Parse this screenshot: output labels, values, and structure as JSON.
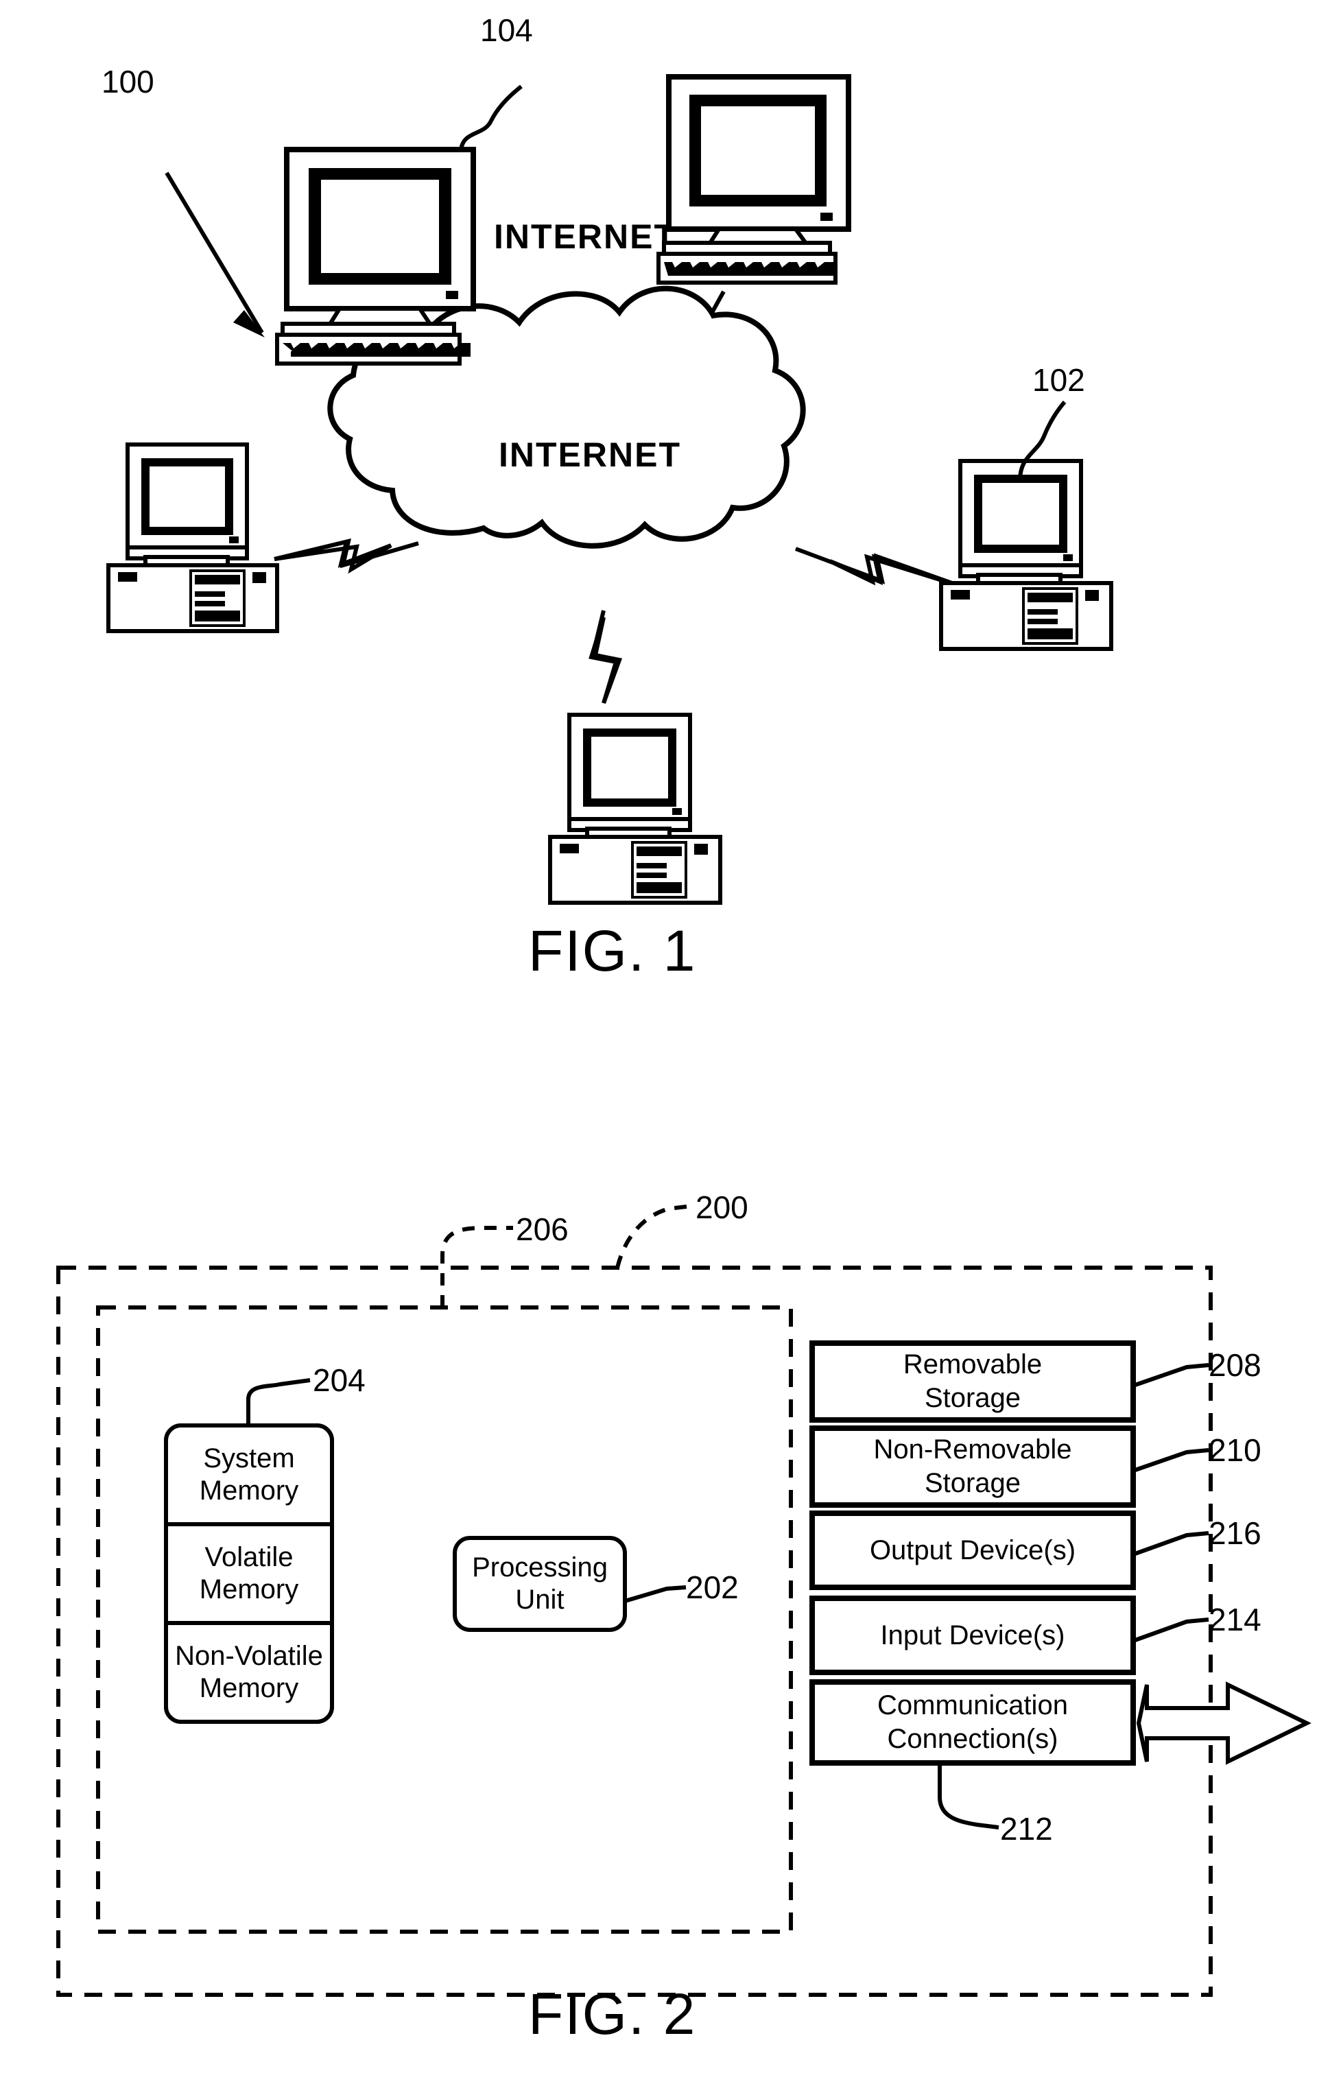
{
  "document": {
    "type": "patent-drawing-sheet",
    "figures": [
      "FIG. 1",
      "FIG. 2"
    ]
  },
  "figure1": {
    "label": "FIG. 1",
    "cloud_label": "INTERNET",
    "reference_numerals": {
      "system": "100",
      "client_right": "102",
      "computer_top_left": "104"
    },
    "nodes": [
      {
        "id": "node-top-left",
        "style": "monitor-keyboard",
        "ref": "104"
      },
      {
        "id": "node-top-right",
        "style": "monitor-keyboard",
        "ref": ""
      },
      {
        "id": "node-left",
        "style": "monitor-tower",
        "ref": ""
      },
      {
        "id": "node-right",
        "style": "monitor-tower",
        "ref": "102"
      },
      {
        "id": "node-bottom",
        "style": "monitor-tower",
        "ref": ""
      }
    ],
    "links": [
      {
        "from": "node-top-left",
        "to": "cloud",
        "style": "lightning"
      },
      {
        "from": "node-top-right",
        "to": "cloud",
        "style": "lightning"
      },
      {
        "from": "node-left",
        "to": "cloud",
        "style": "lightning"
      },
      {
        "from": "node-right",
        "to": "cloud",
        "style": "lightning"
      },
      {
        "from": "node-bottom",
        "to": "cloud",
        "style": "lightning"
      }
    ]
  },
  "figure2": {
    "label": "FIG. 2",
    "reference_numerals": {
      "computing_device": "200",
      "processing_unit": "202",
      "system_memory": "204",
      "basic_configuration": "206",
      "removable_storage": "208",
      "non_removable_storage": "210",
      "communication_connections": "212",
      "input_devices": "214",
      "output_devices": "216"
    },
    "memory_block": {
      "title": "System Memory",
      "sections": [
        {
          "line1": "System",
          "line2": "Memory"
        },
        {
          "line1": "Volatile",
          "line2": "Memory"
        },
        {
          "line1": "Non-Volatile",
          "line2": "Memory"
        }
      ]
    },
    "processing_unit": {
      "line1": "Processing",
      "line2": "Unit"
    },
    "peripheral_boxes": [
      {
        "line1": "Removable",
        "line2": "Storage",
        "ref": "208"
      },
      {
        "line1": "Non-Removable",
        "line2": "Storage",
        "ref": "210"
      },
      {
        "line1": "Output Device(s)",
        "line2": "",
        "ref": "216"
      },
      {
        "line1": "Input Device(s)",
        "line2": "",
        "ref": "214"
      },
      {
        "line1": "Communication",
        "line2": "Connection(s)",
        "ref": "212"
      }
    ],
    "external_arrow": {
      "direction": "bidirectional",
      "name": "communication-arrow"
    }
  },
  "colors": {
    "ink": "#000000",
    "paper": "#ffffff"
  }
}
